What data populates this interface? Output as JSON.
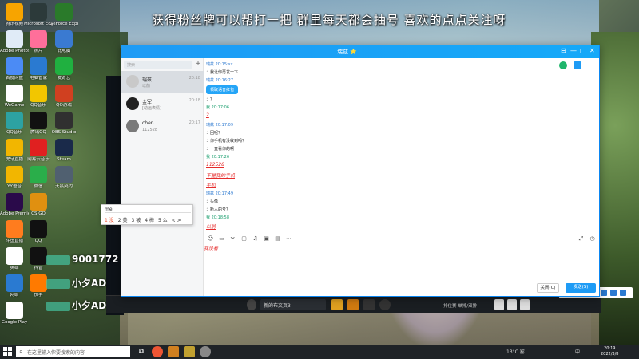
{
  "banner": "获得粉丝牌可以帮打一把 群里每天都会抽号 喜欢的点点关注呀",
  "desktop_icons_left": [
    {
      "label": "腾讯视频",
      "color": "#f7a400"
    },
    {
      "label": "Adobe Photoshop",
      "color": "#e0ebf7"
    },
    {
      "label": "百度网盘",
      "color": "#4b8bf5"
    },
    {
      "label": "WeGame",
      "color": "#ffffff"
    },
    {
      "label": "QQ音乐",
      "color": "#2da2a2"
    },
    {
      "label": "虎牙直播",
      "color": "#f2b600"
    },
    {
      "label": "YY语音",
      "color": "#f2b600"
    },
    {
      "label": "Adobe Premiere Pro",
      "color": "#2a0a4a"
    },
    {
      "label": "斗鱼直播",
      "color": "#ff7c1e"
    },
    {
      "label": "英雄",
      "color": "#ffffff"
    },
    {
      "label": "网络",
      "color": "#2a7ad1"
    },
    {
      "label": "Google Play",
      "color": "#ffffff"
    }
  ],
  "desktop_icons_col2": [
    {
      "label": "Microsoft Edge",
      "color": "#2c3a3a"
    },
    {
      "label": "照片",
      "color": "#ff6f9a"
    },
    {
      "label": "电脑管家",
      "color": "#2a7ad1"
    },
    {
      "label": "QQ音乐",
      "color": "#f2c600"
    },
    {
      "label": "腾讯QQ",
      "color": "#111111"
    },
    {
      "label": "网易云音乐",
      "color": "#e02020"
    },
    {
      "label": "微信",
      "color": "#2aae4a"
    },
    {
      "label": "CS:GO",
      "color": "#e09010"
    },
    {
      "label": "QQ",
      "color": "#111111"
    },
    {
      "label": "抖音",
      "color": "#111111"
    },
    {
      "label": "快手",
      "color": "#ff7a00"
    }
  ],
  "desktop_icons_col3": [
    {
      "label": "GeForce Experience",
      "color": "#2a7a2a"
    },
    {
      "label": "此电脑",
      "color": "#3a7ad1"
    },
    {
      "label": "爱奇艺",
      "color": "#20b040"
    },
    {
      "label": "QQ游戏",
      "color": "#d04020"
    },
    {
      "label": "OBS Studio",
      "color": "#303030"
    },
    {
      "label": "Steam",
      "color": "#1a2a4a"
    },
    {
      "label": "无畏契约",
      "color": "#506070"
    }
  ],
  "overlay": {
    "count": "9001772",
    "name1": "小夕AD",
    "name2": "小夕AD"
  },
  "chat": {
    "window_title": "瑞兹 ⭐",
    "search_placeholder": "搜索",
    "add_label": "+",
    "contacts": [
      {
        "name": "瑞兹",
        "sub": "以前",
        "time": "20:18",
        "color": "#c9c9c9"
      },
      {
        "name": "金军",
        "sub": "[动画表情]",
        "time": "20:18",
        "color": "#222222"
      },
      {
        "name": "chen",
        "sub": "112528",
        "time": "20:17",
        "color": "#7a7a7a"
      }
    ],
    "messages": [
      {
        "text": "瑞兹 20:15:xx",
        "style": "meta"
      },
      {
        "text": "：我让你再发一下",
        "style": ""
      },
      {
        "text": "瑞兹 20:16:27",
        "style": "meta"
      },
      {
        "text": "领取语音红包",
        "style": "bubble"
      },
      {
        "text": "：？",
        "style": ""
      },
      {
        "text": "我 20:17:06",
        "style": "meta2"
      },
      {
        "text": "2",
        "style": "red"
      },
      {
        "text": "瑞兹 20:17:09",
        "style": "meta"
      },
      {
        "text": "：回呢？",
        "style": ""
      },
      {
        "text": "：你手机有没收到吗？",
        "style": ""
      },
      {
        "text": "：一直看你的啊",
        "style": ""
      },
      {
        "text": "我 20:17:26",
        "style": "meta2"
      },
      {
        "text": "112528",
        "style": "red"
      },
      {
        "text": "不是我的手机",
        "style": "red"
      },
      {
        "text": "手机",
        "style": "red"
      },
      {
        "text": "瑞兹 20:17:49",
        "style": "meta"
      },
      {
        "text": "：头像",
        "style": ""
      },
      {
        "text": "：新人的号？",
        "style": ""
      },
      {
        "text": "我 20:18:58",
        "style": "meta2"
      },
      {
        "text": "以前",
        "style": "red"
      }
    ],
    "input_text": "我没看",
    "ime": {
      "typed": "mei",
      "candidates": [
        "1 没",
        "2 美",
        "3 被",
        "4 梅",
        "5 么"
      ],
      "page": "< >"
    },
    "close_label": "关闭(C)",
    "send_label": "发送(S)"
  },
  "stream_bar": {
    "source_label": "新的布文页3",
    "right_label": "排位赛 单排/双排"
  },
  "taskbar": {
    "search_placeholder": "在这里输入你要搜索的内容",
    "weather": "13°C 雾",
    "ime": "中",
    "time": "20:19",
    "date": "2022/3/8"
  }
}
